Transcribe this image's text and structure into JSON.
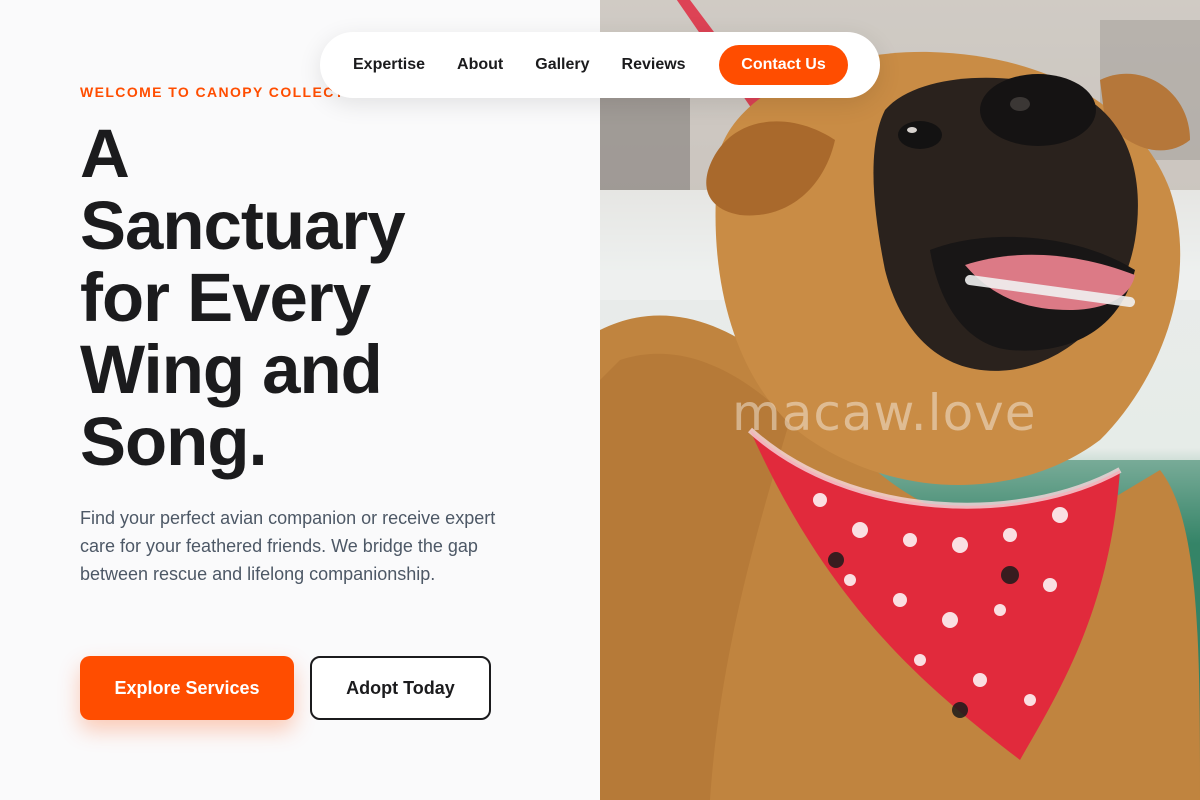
{
  "nav": {
    "links": [
      "Expertise",
      "About",
      "Gallery",
      "Reviews"
    ],
    "cta_label": "Contact Us"
  },
  "hero": {
    "eyebrow": "WELCOME TO CANOPY COLLECT",
    "headline_lines": [
      "A",
      "Sanctuary",
      "for Every",
      "Wing and",
      "Song."
    ],
    "lede": "Find your perfect avian companion or receive expert care for your feathered friends. We bridge the gap between rescue and lifelong companionship.",
    "primary_button": "Explore Services",
    "secondary_button": "Adopt Today"
  },
  "photo": {
    "subject": "smiling dog wearing a red bandana",
    "watermark": "macaw.love"
  },
  "colors": {
    "accent": "#ff4d00",
    "text": "#1b1b1d",
    "muted": "#4d5866",
    "background": "#fafafb"
  }
}
